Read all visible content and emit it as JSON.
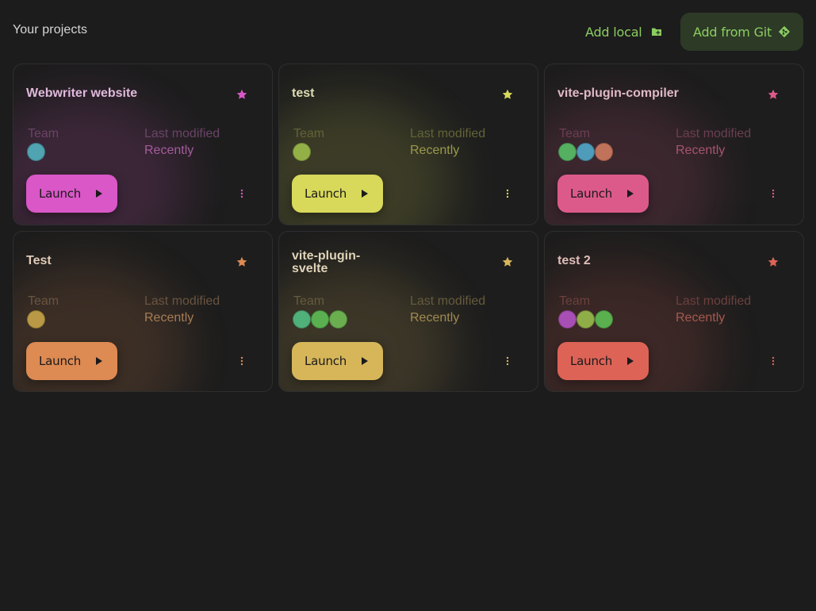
{
  "header": {
    "title": "Your projects",
    "add_local_label": "Add local",
    "add_git_label": "Add from Git",
    "accent": "#8ccd62",
    "git_button_bg": "#2d3a26"
  },
  "projects": [
    {
      "title": "Webwriter website",
      "accent": "#d957c7",
      "title_color": "#dfb9db",
      "label_color": "#6a4466",
      "value_color": "#a45b9b",
      "team_label": "Team",
      "modified_label": "Last modified",
      "modified_value": "Recently",
      "avatars": [
        "#50a3b0"
      ],
      "launch_label": "Launch",
      "starred": true
    },
    {
      "title": "test",
      "accent": "#d8d85a",
      "title_color": "#dcdcb3",
      "label_color": "#636338",
      "value_color": "#9a9a4c",
      "team_label": "Team",
      "modified_label": "Last modified",
      "modified_value": "Recently",
      "avatars": [
        "#93b047"
      ],
      "launch_label": "Launch",
      "starred": true
    },
    {
      "title": "vite-plugin-compiler",
      "accent": "#dc5a8a",
      "title_color": "#e0b9c6",
      "label_color": "#6b3f50",
      "value_color": "#a6546f",
      "team_label": "Team",
      "modified_label": "Last modified",
      "modified_value": "Recently",
      "avatars": [
        "#55b061",
        "#4f9cba",
        "#c0735a"
      ],
      "launch_label": "Launch",
      "starred": true
    },
    {
      "title": "Test",
      "accent": "#dd8a53",
      "title_color": "#e0cbb9",
      "label_color": "#6a5440",
      "value_color": "#a67c54",
      "team_label": "Team",
      "modified_label": "Last modified",
      "modified_value": "Recently",
      "avatars": [
        "#b99945"
      ],
      "launch_label": "Launch",
      "starred": true
    },
    {
      "title": "vite-plugin-\nsvelte",
      "accent": "#d7b65a",
      "title_color": "#dfd3b8",
      "label_color": "#665a3d",
      "value_color": "#a08a50",
      "team_label": "Team",
      "modified_label": "Last modified",
      "modified_value": "Recently",
      "avatars": [
        "#50b07a",
        "#5ab050",
        "#6aae4f"
      ],
      "launch_label": "Launch",
      "starred": true
    },
    {
      "title": "test 2",
      "accent": "#dd6357",
      "title_color": "#e0bcb8",
      "label_color": "#6a403d",
      "value_color": "#a65950",
      "team_label": "Team",
      "modified_label": "Last modified",
      "modified_value": "Recently",
      "avatars": [
        "#a84fb5",
        "#8fae48",
        "#5aaf4f"
      ],
      "launch_label": "Launch",
      "starred": true
    }
  ]
}
